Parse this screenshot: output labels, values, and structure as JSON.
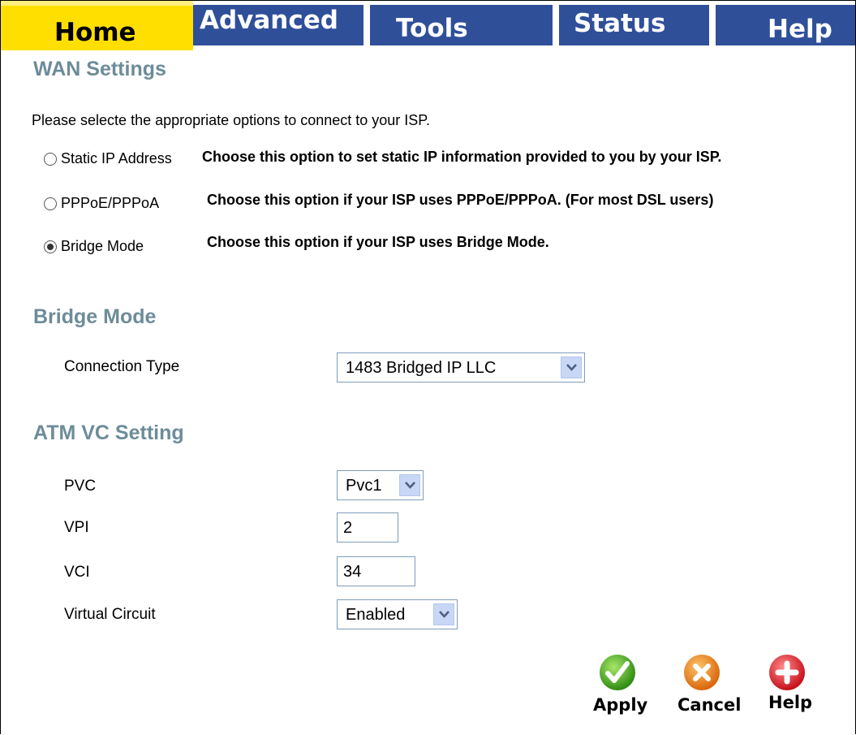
{
  "tabs": {
    "home": "Home",
    "advanced": "Advanced",
    "tools": "Tools",
    "status": "Status",
    "help": "Help"
  },
  "wan": {
    "title": "WAN Settings",
    "intro": "Please selecte the appropriate options to connect to your ISP.",
    "options": [
      {
        "label": "Static IP Address",
        "desc": "Choose this option to set static IP information provided to you by your ISP.",
        "selected": false
      },
      {
        "label": "PPPoE/PPPoA",
        "desc": "Choose this option if your ISP uses PPPoE/PPPoA. (For most DSL users)",
        "selected": false
      },
      {
        "label": "Bridge Mode",
        "desc": "Choose this option if your ISP uses Bridge Mode.",
        "selected": true
      }
    ]
  },
  "bridge": {
    "title": "Bridge Mode",
    "connection_type_label": "Connection Type",
    "connection_type_value": "1483 Bridged IP LLC"
  },
  "atm": {
    "title": "ATM VC Setting",
    "pvc_label": "PVC",
    "pvc_value": "Pvc1",
    "vpi_label": "VPI",
    "vpi_value": "2",
    "vci_label": "VCI",
    "vci_value": "34",
    "vc_label": "Virtual Circuit",
    "vc_value": "Enabled"
  },
  "actions": {
    "apply": "Apply",
    "cancel": "Cancel",
    "help": "Help"
  },
  "colors": {
    "home_tab": "#ffdf00",
    "nav_tab": "#2f4f99",
    "section_title": "#6d8c99",
    "apply_icon": "#4caf1f",
    "cancel_icon": "#f08a1c",
    "help_icon": "#e0202a"
  }
}
